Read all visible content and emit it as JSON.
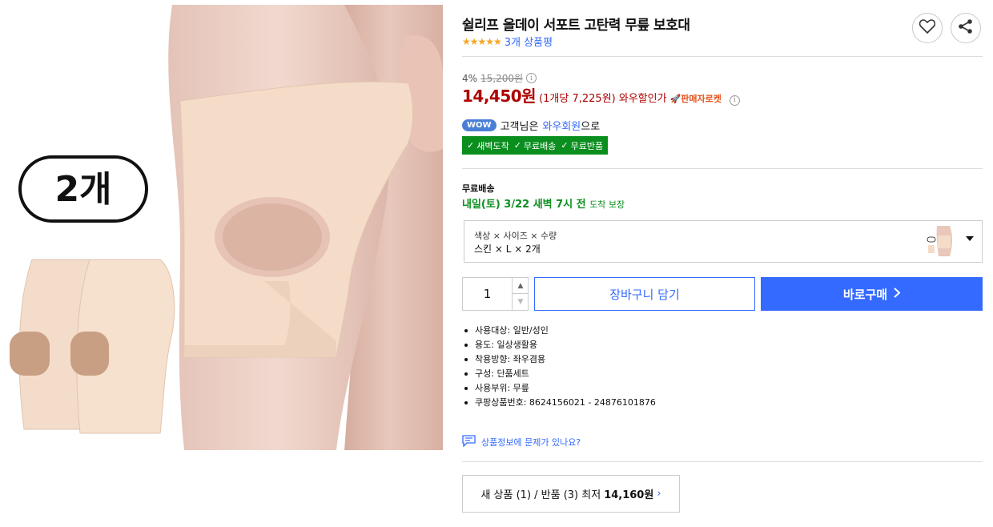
{
  "product_image": {
    "badge_text": "2개"
  },
  "product": {
    "title": "쉴리프 올데이 서포트 고탄력 무릎 보호대",
    "stars": "★★★★★",
    "review_count": "3개 상품평"
  },
  "actions": {
    "like_icon": "heart-icon",
    "share_icon": "share-icon"
  },
  "price": {
    "discount_rate": "4%",
    "original_price": "15,200원",
    "sale_price": "14,450원",
    "unit_price": "(1개당 7,225원)",
    "wow_discount": "와우할인가",
    "rocket_label": "판매자로켓"
  },
  "membership": {
    "wow_badge": "WOW",
    "prefix": "고객님은",
    "link": "와우회원",
    "suffix": "으로",
    "benefits": [
      "새벽도착",
      "무료배송",
      "무료반품"
    ]
  },
  "shipping": {
    "label": "무료배송",
    "date": "내일(토) 3/22 새벽 7시 전",
    "guarantee": "도착 보장"
  },
  "option": {
    "labels": "색상 × 사이즈 × 수량",
    "values": "스킨 × L × 2개"
  },
  "purchase": {
    "quantity": "1",
    "cart_label": "장바구니 담기",
    "buy_label": "바로구매"
  },
  "attributes": [
    "사용대상: 일반/성인",
    "용도: 일상생활용",
    "착용방향: 좌우겸용",
    "구성: 단품세트",
    "사용부위: 무릎",
    "쿠팡상품번호: 8624156021 - 24876101876"
  ],
  "report": {
    "label": "상품정보에 문제가 있나요?"
  },
  "used_offer": {
    "text": "새 상품 (1) / 반품 (3) 최저",
    "price": "14,160원",
    "chevron": "›"
  },
  "colors": {
    "accent": "#346aff",
    "price_red": "#ae0000",
    "rocket_green": "#0a8f1f",
    "star": "#f5a623"
  }
}
